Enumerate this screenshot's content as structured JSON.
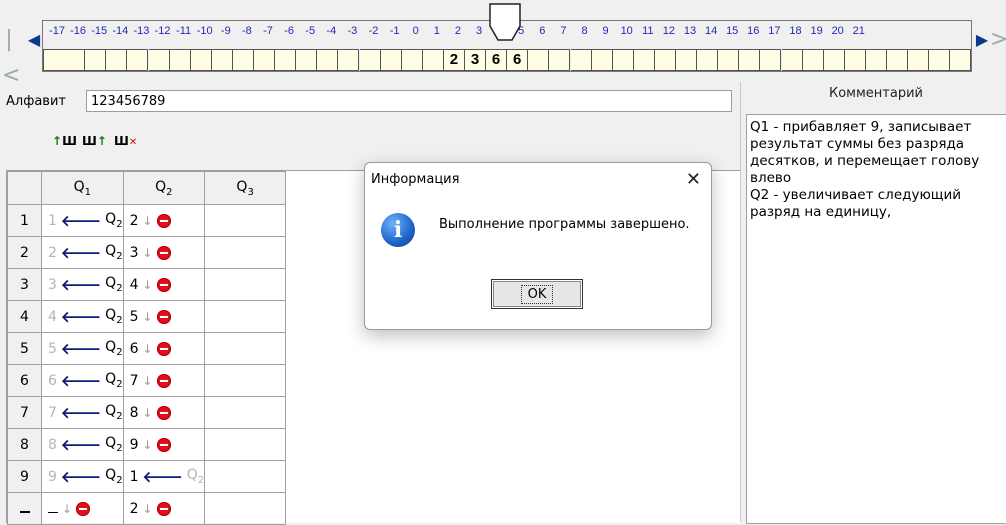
{
  "tape": {
    "positions": [
      "-17",
      "-16",
      "-15",
      "-14",
      "-13",
      "-12",
      "-11",
      "-10",
      "-9",
      "-8",
      "-7",
      "-6",
      "-5",
      "-4",
      "-3",
      "-2",
      "-1",
      "0",
      "1",
      "2",
      "3",
      "4",
      "5",
      "6",
      "7",
      "8",
      "9",
      "10",
      "11",
      "12",
      "13",
      "14",
      "15",
      "16",
      "17",
      "18",
      "19",
      "20",
      "21"
    ],
    "cells": [
      "",
      "",
      "",
      "",
      "",
      "",
      "",
      "",
      "",
      "",
      "",
      "",
      "",
      "",
      "",
      "",
      "",
      "",
      "",
      "",
      "",
      "",
      "",
      "",
      "",
      "",
      "",
      "",
      "",
      "",
      "",
      "",
      "",
      "",
      "",
      "",
      "",
      "",
      ""
    ],
    "filled": [
      {
        "index": 19,
        "value": "2"
      },
      {
        "index": 20,
        "value": "3"
      },
      {
        "index": 21,
        "value": "6"
      },
      {
        "index": 22,
        "value": "6"
      }
    ],
    "head_position": "2"
  },
  "alphabet": {
    "label": "Алфавит",
    "value": "123456789"
  },
  "comment": {
    "title": "Комментарий",
    "text": "Q1 - прибавляет 9, записывает результат суммы без разряда десятков, и перемещает голову влево\nQ2 - увеличивает следующий разряд на единицу,"
  },
  "table": {
    "columns": [
      "Q1",
      "Q2",
      "Q3"
    ],
    "rows": [
      {
        "symbol": "1",
        "q1": {
          "write": "1",
          "move": "left",
          "next": "Q2"
        },
        "q2": {
          "write": "2",
          "move": "stay",
          "next": "stop"
        }
      },
      {
        "symbol": "2",
        "q1": {
          "write": "2",
          "move": "left",
          "next": "Q2"
        },
        "q2": {
          "write": "3",
          "move": "stay",
          "next": "stop"
        }
      },
      {
        "symbol": "3",
        "q1": {
          "write": "3",
          "move": "left",
          "next": "Q2"
        },
        "q2": {
          "write": "4",
          "move": "stay",
          "next": "stop"
        }
      },
      {
        "symbol": "4",
        "q1": {
          "write": "4",
          "move": "left",
          "next": "Q2"
        },
        "q2": {
          "write": "5",
          "move": "stay",
          "next": "stop"
        }
      },
      {
        "symbol": "5",
        "q1": {
          "write": "5",
          "move": "left",
          "next": "Q2"
        },
        "q2": {
          "write": "6",
          "move": "stay",
          "next": "stop"
        }
      },
      {
        "symbol": "6",
        "q1": {
          "write": "6",
          "move": "left",
          "next": "Q2"
        },
        "q2": {
          "write": "7",
          "move": "stay",
          "next": "stop"
        }
      },
      {
        "symbol": "7",
        "q1": {
          "write": "7",
          "move": "left",
          "next": "Q2"
        },
        "q2": {
          "write": "8",
          "move": "stay",
          "next": "stop"
        }
      },
      {
        "symbol": "8",
        "q1": {
          "write": "8",
          "move": "left",
          "next": "Q2"
        },
        "q2": {
          "write": "9",
          "move": "stay",
          "next": "stop"
        }
      },
      {
        "symbol": "9",
        "q1": {
          "write": "9",
          "move": "left",
          "next": "Q2"
        },
        "q2": {
          "write": "1",
          "move": "left",
          "next": "Q2"
        }
      },
      {
        "symbol": "_",
        "q1": {
          "write": "_",
          "move": "stay",
          "next": "stop"
        },
        "q2": {
          "write": "2",
          "move": "stay",
          "next": "stop"
        }
      }
    ]
  },
  "dialog": {
    "title": "Информация",
    "message": "Выполнение программы завершено.",
    "ok_label": "OK"
  },
  "colors": {
    "tape_cell_bg": "#fffde6",
    "tape_number": "#1e2bb0",
    "arrow": "#0a1f7a",
    "stop": "#e0101a",
    "info_icon": "#1e63c7"
  }
}
